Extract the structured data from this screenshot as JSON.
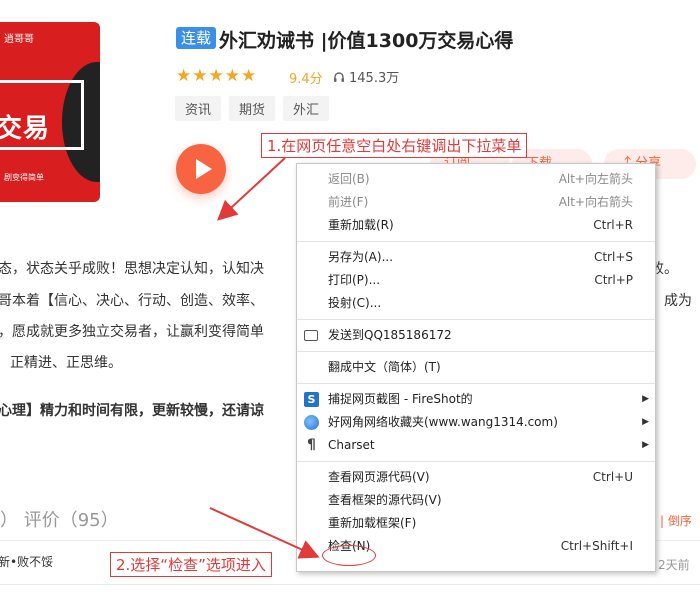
{
  "album": {
    "cover": {
      "top_text": "逍哥哥",
      "big_text": "交易",
      "small_text": "剧变得简单"
    },
    "series_badge": "连载",
    "title": "外汇劝诫书 |价值1300万交易心得",
    "stars": "★★★★★",
    "rating_value": 4.5,
    "rating_text": "9.4分",
    "plays": "145.3万",
    "tags": [
      "资讯",
      "期货",
      "外汇"
    ],
    "actions": {
      "subscribe": "订阅",
      "download": "下载",
      "share": "分享"
    }
  },
  "description": {
    "line1": "态，状态关乎成败！思想决定认知，认知决",
    "line1_end": "败。",
    "line2": "哥本着【信心、决心、行动、创造、效率、",
    "line2_end": "成为",
    "line3": "，愿成就更多独立交易者，让赢利变得简单",
    "line4": "正精进、正思维。",
    "line5": "心理】精力和时间有限，更新较慢，还请谅"
  },
  "reviews": {
    "label": "） 评价（95）",
    "side_link": "| 倒序",
    "comment": "新•败不馁",
    "time": "2天前"
  },
  "context_menu": {
    "items": [
      {
        "label": "返回(B)",
        "shortcut": "Alt+向左箭头",
        "disabled": true
      },
      {
        "label": "前进(F)",
        "shortcut": "Alt+向右箭头",
        "disabled": true
      },
      {
        "label": "重新加载(R)",
        "shortcut": "Ctrl+R"
      },
      {
        "label": "另存为(A)...",
        "shortcut": "Ctrl+S"
      },
      {
        "label": "打印(P)...",
        "shortcut": "Ctrl+P"
      },
      {
        "label": "投射(C)...",
        "shortcut": ""
      },
      {
        "label": "发送到QQ185186172",
        "shortcut": ""
      },
      {
        "label": "翻成中文（简体）(T)",
        "shortcut": ""
      },
      {
        "label": "捕捉网页截图 - FireShot的",
        "shortcut": ""
      },
      {
        "label": "好网角网络收藏夹(www.wang1314.com)",
        "shortcut": ""
      },
      {
        "label": "Charset",
        "shortcut": ""
      },
      {
        "label": "查看网页源代码(V)",
        "shortcut": "Ctrl+U"
      },
      {
        "label": "查看框架的源代码(V)",
        "shortcut": ""
      },
      {
        "label": "重新加载框架(F)",
        "shortcut": ""
      },
      {
        "label": "检查(N)",
        "shortcut": "Ctrl+Shift+I"
      }
    ],
    "icons": {
      "fireshot": "S",
      "charset": "¶"
    }
  },
  "annotations": {
    "step1": "1.在网页任意空白处右键调出下拉菜单",
    "step2": "2.选择“检查”选项进入"
  },
  "colors": {
    "accent": "#f86442",
    "badge": "#3a8fe6",
    "annotation": "#e23a3a",
    "star": "#f5a623"
  }
}
